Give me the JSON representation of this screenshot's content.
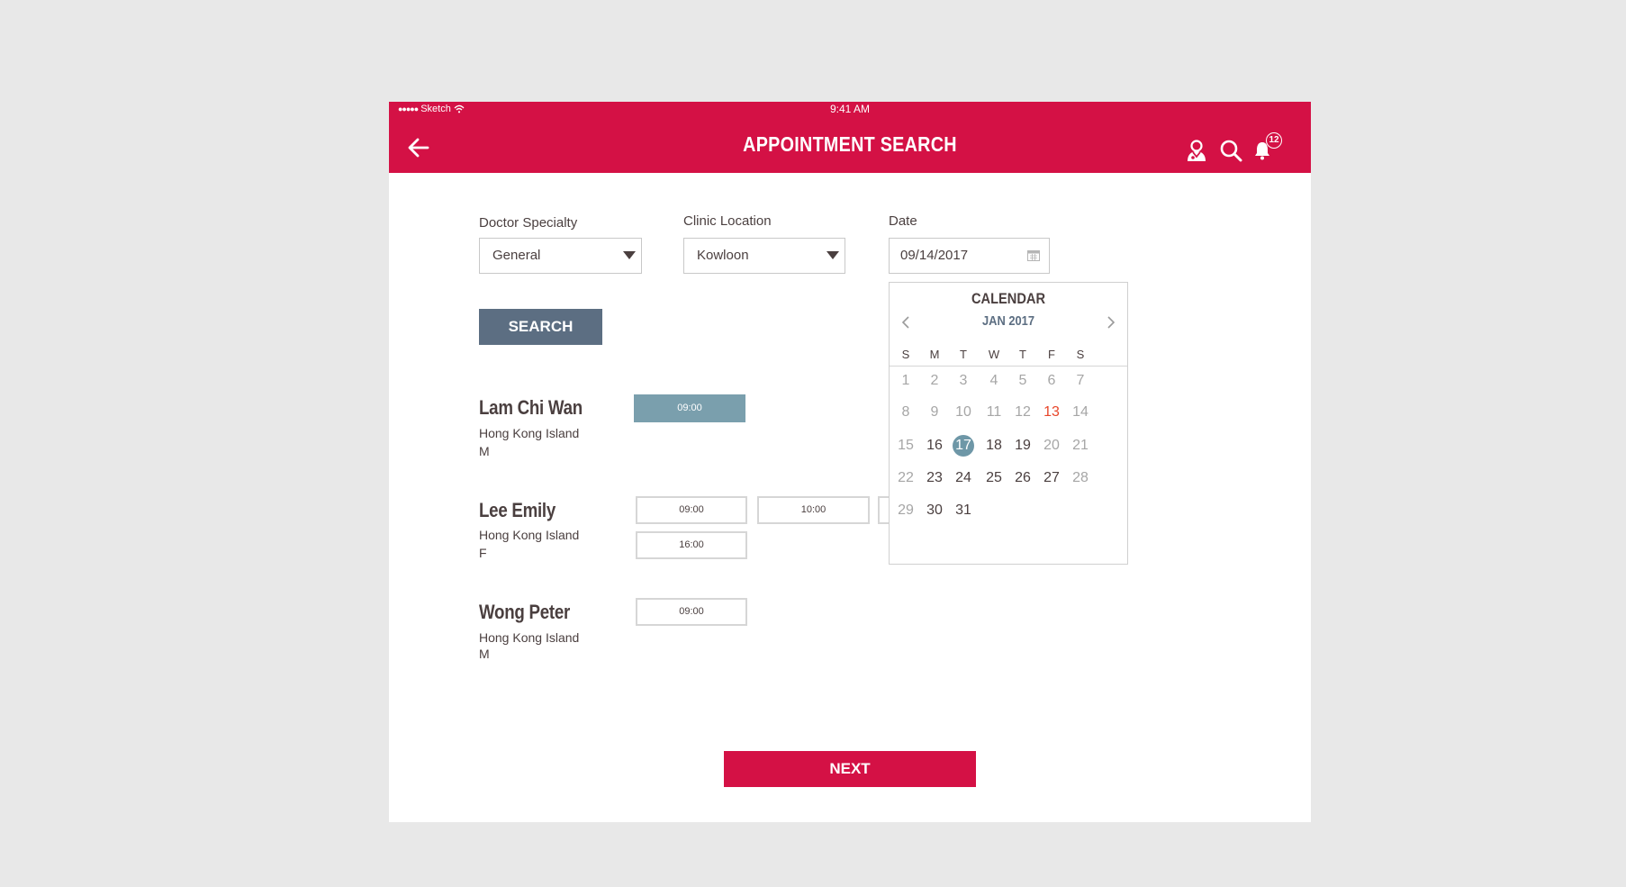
{
  "status_bar": {
    "carrier": "Sketch",
    "time": "9:41 AM"
  },
  "header": {
    "title": "APPOINTMENT SEARCH",
    "notification_count": "12"
  },
  "filters": {
    "specialty_label": "Doctor Specialty",
    "specialty_value": "General",
    "location_label": "Clinic Location",
    "location_value": "Kowloon",
    "date_label": "Date",
    "date_value": "09/14/2017"
  },
  "search_label": "SEARCH",
  "doctors": [
    {
      "name": "Lam Chi Wan",
      "region": "Hong Kong Island",
      "gender": "M",
      "slots": [
        "09:00"
      ]
    },
    {
      "name": "Lee Emily",
      "region": "Hong Kong Island",
      "gender": "F",
      "slots": [
        "09:00",
        "10:00",
        "",
        "16:00"
      ]
    },
    {
      "name": "Wong Peter",
      "region": "Hong Kong Island",
      "gender": "M",
      "slots": [
        "09:00"
      ]
    }
  ],
  "calendar": {
    "title": "CALENDAR",
    "month": "JAN 2017",
    "weekdays": [
      "S",
      "M",
      "T",
      "W",
      "T",
      "F",
      "S"
    ],
    "weeks": [
      [
        "1",
        "2",
        "3",
        "4",
        "5",
        "6",
        "7"
      ],
      [
        "8",
        "9",
        "10",
        "11",
        "12",
        "13",
        "14"
      ],
      [
        "15",
        "16",
        "17",
        "18",
        "19",
        "20",
        "21"
      ],
      [
        "22",
        "23",
        "24",
        "25",
        "26",
        "27",
        "28"
      ],
      [
        "29",
        "30",
        "31"
      ]
    ],
    "today": "13",
    "selected": "17",
    "first_available": "16",
    "available_days": [
      "16",
      "17",
      "18",
      "19",
      "23",
      "24",
      "25",
      "26",
      "27",
      "30",
      "31"
    ]
  },
  "next_label": "NEXT",
  "colors": {
    "brand_red": "#d41145",
    "search_button": "#5c6e82",
    "selected_slot": "#7a9fad",
    "today_text": "#e8462a"
  }
}
